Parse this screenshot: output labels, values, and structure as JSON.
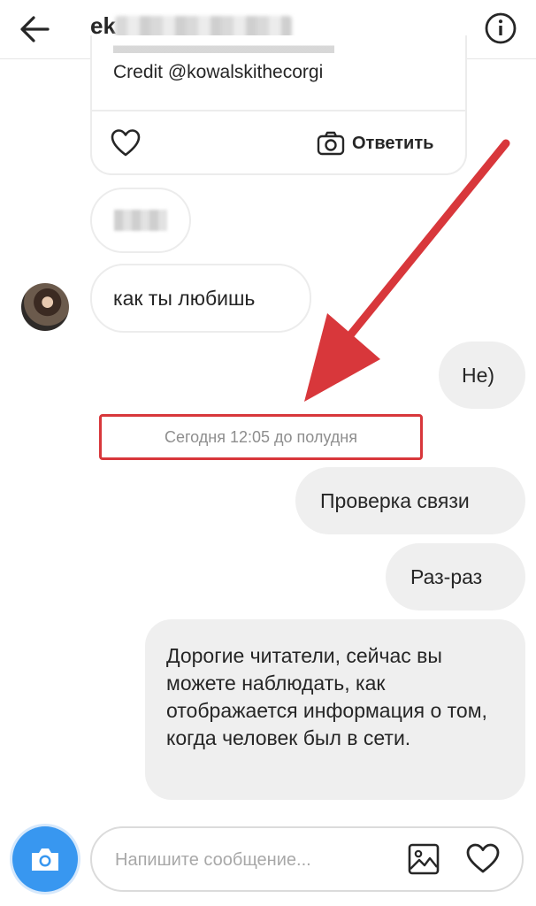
{
  "header": {
    "username_visible": "ek",
    "back_icon": "arrow-left-icon",
    "info_icon": "info-circle-icon"
  },
  "post_card": {
    "credit": "Credit @kowalskithecorgi",
    "reply_label": "Ответить",
    "heart_icon": "heart-outline-icon",
    "camera_icon": "camera-icon"
  },
  "messages": [
    {
      "text": "как ты любишь",
      "direction": "incoming"
    },
    {
      "text": "Не)",
      "direction": "outgoing"
    },
    {
      "text": "Проверка связи",
      "direction": "outgoing"
    },
    {
      "text": "Раз-раз",
      "direction": "outgoing"
    },
    {
      "text": "Дорогие читатели, сейчас вы можете наблюдать, как отображается информация о том, когда человек был в сети.",
      "direction": "outgoing"
    }
  ],
  "timestamp": "Сегодня 12:05 до полудня",
  "composer": {
    "placeholder": "Напишите сообщение...",
    "camera_icon": "camera-icon",
    "gallery_icon": "image-icon",
    "like_icon": "heart-outline-icon"
  },
  "colors": {
    "annotation_red": "#d8373b",
    "composer_camera_blue": "#3897f0",
    "outgoing_bubble": "#efefef",
    "timestamp_text": "#8e8e8e"
  }
}
